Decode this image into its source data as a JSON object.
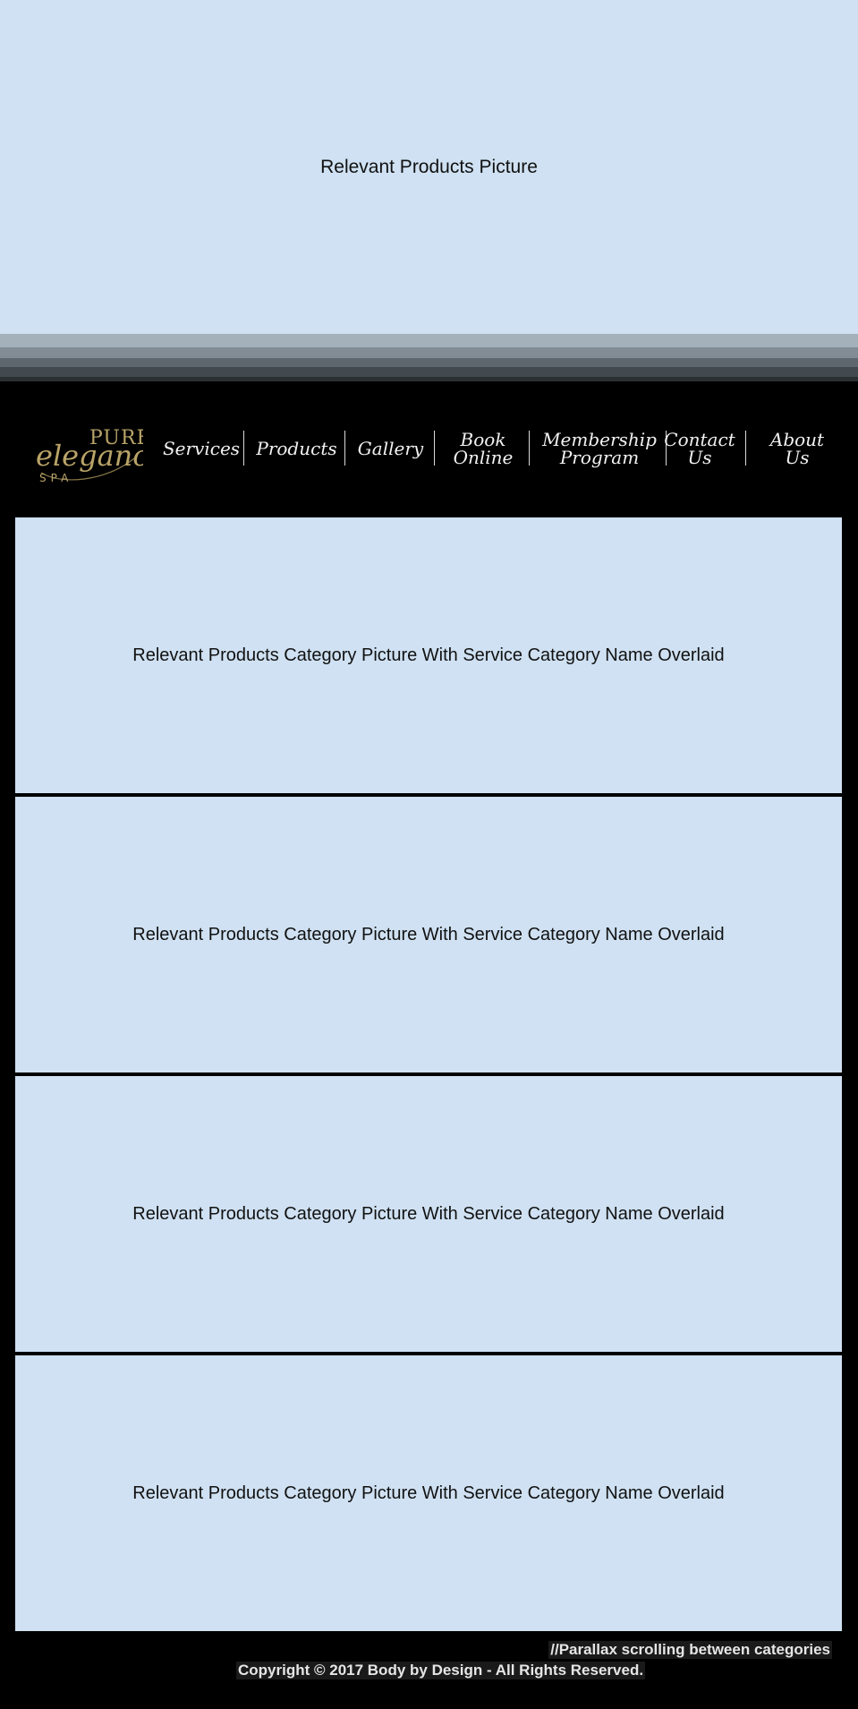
{
  "hero": {
    "caption": "Relevant Products Picture"
  },
  "logo": {
    "line1": "PURE",
    "line2": "elegance",
    "line3": "SPA",
    "color": "#b9a468"
  },
  "nav": {
    "items": [
      {
        "label": "Services"
      },
      {
        "label": "Products"
      },
      {
        "label": "Gallery"
      },
      {
        "label_line1": "Book",
        "label_line2": "Online"
      },
      {
        "label_line1": "Membership",
        "label_line2": "Program"
      },
      {
        "label_line1": "Contact",
        "label_line2": "Us"
      },
      {
        "label": "About Us"
      }
    ]
  },
  "categories": [
    {
      "caption": "Relevant Products Category Picture With Service Category Name Overlaid"
    },
    {
      "caption": "Relevant Products Category Picture With Service Category Name Overlaid"
    },
    {
      "caption": "Relevant Products Category Picture With Service Category Name Overlaid"
    },
    {
      "caption": "Relevant Products Category Picture With Service Category Name Overlaid"
    }
  ],
  "footer": {
    "parallax_note": "//Parallax scrolling between categories",
    "copyright": "Copyright © 2017 Body by Design - All Rights Reserved."
  },
  "colors": {
    "page_background": "#000000",
    "placeholder_background": "#cfe1f2",
    "nav_text": "#f1f1f1",
    "footer_text": "#e6e6e6"
  }
}
